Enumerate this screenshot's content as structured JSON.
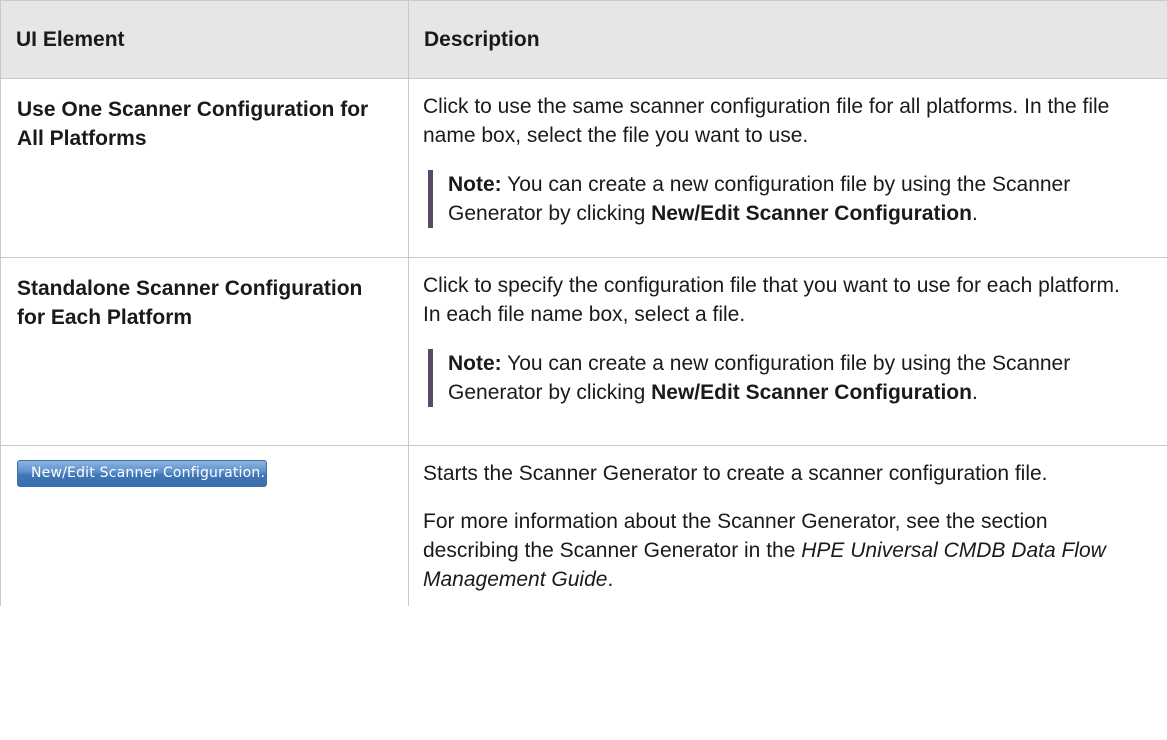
{
  "table": {
    "headers": {
      "element": "UI Element",
      "description": "Description"
    },
    "rows": [
      {
        "element": "Use One Scanner Configuration for All Platforms",
        "description": "Click to use the same scanner configuration file for all platforms. In the file name box, select the file you want to use.",
        "note": {
          "label": "Note:",
          "text": " You can create a new configuration file by using the Scanner Generator by clicking ",
          "bold": "New/Edit Scanner Configuration",
          "end": "."
        }
      },
      {
        "element": "Standalone Scanner Configuration for Each Platform",
        "description": "Click to specify the configuration file that you want to use for each platform. In each file name box, select a file.",
        "note": {
          "label": "Note:",
          "text": " You can create a new configuration file by using the Scanner Generator by clicking ",
          "bold": "New/Edit Scanner Configuration",
          "end": "."
        }
      },
      {
        "button_label": "New/Edit Scanner Configuration...",
        "description": "Starts the Scanner Generator to create a scanner configuration file.",
        "more_info": {
          "text": "For more information about the Scanner Generator, see the section describing the Scanner Generator in the ",
          "italic": "HPE Universal CMDB Data Flow Management Guide",
          "end": "."
        }
      }
    ]
  }
}
